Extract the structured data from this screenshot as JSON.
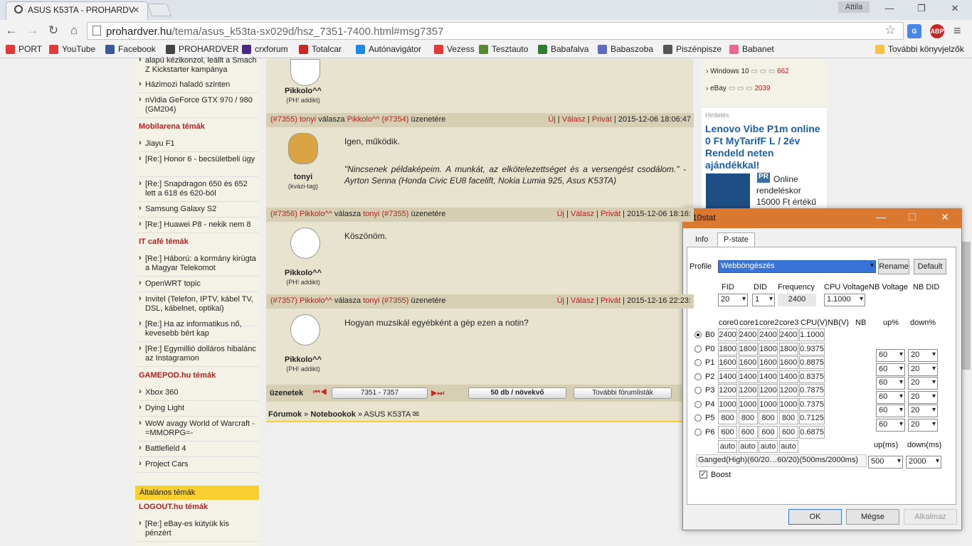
{
  "browser": {
    "tab_title": "ASUS K53TA - PROHARDV",
    "user": "Attila",
    "url_host": "prohardver.hu",
    "url_path": "/tema/asus_k53ta-sx029d/hsz_7351-7400.html#msg7357",
    "ext_abp": "ABP"
  },
  "bookmarks": [
    {
      "label": "PORT",
      "color": "#e53935"
    },
    {
      "label": "YouTube",
      "color": "#e53935"
    },
    {
      "label": "Facebook",
      "color": "#3b5998"
    },
    {
      "label": "PROHARDVER",
      "color": "#444444"
    },
    {
      "label": "crxforum",
      "color": "#4a2a80"
    },
    {
      "label": "Totalcar",
      "color": "#c62828"
    },
    {
      "label": "Autónavigátor",
      "color": "#1e88e5"
    },
    {
      "label": "Vezess",
      "color": "#e53935"
    },
    {
      "label": "Tesztauto",
      "color": "#558b2f"
    },
    {
      "label": "Babafalva",
      "color": "#2e7d32"
    },
    {
      "label": "Babaszoba",
      "color": "#5c6bc0"
    },
    {
      "label": "Piszénpisze",
      "color": "#555555"
    },
    {
      "label": "Babanet",
      "color": "#f06292"
    }
  ],
  "other_bookmarks": "További könyvjelzők",
  "sidebar": {
    "top_items": [
      "alapú kézikonzol, leállt a Smach Z Kickstarter kampánya",
      "Házimozi haladó szinten",
      "nVidia GeForce GTX 970 / 980 (GM204)"
    ],
    "mobilarena_head": "Mobilarena témák",
    "mobilarena": [
      "Jiayu F1",
      "[Re:] Honor 6 - becsületbeli ügy",
      "[Re:] Snapdragon 650 és 652 lett a 618 és 620-ból",
      "Samsung Galaxy S2",
      "[Re:] Huawei P8 - nekik nem 8"
    ],
    "itcafe_head": "IT café témák",
    "itcafe": [
      "[Re:] Háború: a kormány kirúgta a Magyar Telekomot",
      "OpenWRT topic",
      "Invitel (Telefon, IPTV, kábel TV, DSL, kábelnet, optikai)",
      "[Re:] Ha az informatikus nő, kevesebb bért kap",
      "[Re:] Egymillió dolláros hibalánc az Instagramon"
    ],
    "gamepod_head": "GAMEPOD.hu témák",
    "gamepod": [
      "Xbox 360",
      "Dying Light",
      "WoW avagy World of Warcraft -=MMORPG=-",
      "Battlefield 4",
      "Project Cars"
    ],
    "altalanos_head": "Általános témák",
    "logout_head": "LOGOUT.hu témák",
    "logout": [
      "[Re:] eBay-es kütyük kis pénzért"
    ]
  },
  "posts": [
    {
      "num": "(#7355)",
      "author": "tonyi",
      "reply_word": "válasza",
      "target": "Pikkolo^^",
      "target_num": "(#7354)",
      "tail": "üzenetére",
      "uj": "Új",
      "valasz": "Válasz",
      "privat": "Privát",
      "date": "2015-12-06 18:06:47",
      "text": "Igen, működik.",
      "quote": "\"Nincsenek példaképeim. A munkát, az elkötelezettséget és a versengést csodálom.\" - Ayrton Senna (Honda Civic EU8 facelift, Nokia Lumia 925, Asus K53TA)",
      "uname": "tonyi",
      "urank": "(kvázi-tag)"
    },
    {
      "num": "(#7356)",
      "author": "Pikkolo^^",
      "reply_word": "válasza",
      "target": "tonyi",
      "target_num": "(#7355)",
      "tail": "üzenetére",
      "uj": "Új",
      "valasz": "Válasz",
      "privat": "Privát",
      "date": "2015-12-06 18:16:",
      "text": "Köszönöm.",
      "uname": "Pikkolo^^",
      "urank": "(PH! addikt)"
    },
    {
      "num": "(#7357)",
      "author": "Pikkolo^^",
      "reply_word": "válasza",
      "target": "tonyi",
      "target_num": "(#7355)",
      "tail": "üzenetére",
      "uj": "Új",
      "valasz": "Válasz",
      "privat": "Privát",
      "date": "2015-12-16 22:23:",
      "text": "Hogyan muzsikál egyébként a gép ezen a notin?",
      "uname": "Pikkolo^^",
      "urank": "(PH! addikt)"
    }
  ],
  "prev_user": {
    "uname": "Pikkolo^^",
    "urank": "(PH! addikt)"
  },
  "pager": {
    "label": "üzenetek",
    "range": "7351 - 7357",
    "perpage": "50 db / növekvő",
    "more": "További fórumlisták"
  },
  "breadcrumb": {
    "a": "Fórumok",
    "b": "Notebookok",
    "c": "ASUS K53TA",
    "sep": "»"
  },
  "right": {
    "items": [
      {
        "label": "Windows 10",
        "count": "662"
      },
      {
        "label": "eBay",
        "count": "2039"
      }
    ],
    "ad_label": "Hirdetés",
    "ad_title": "Lenovo Vibe P1m online 0 Ft MyTarifF L / 2év Rendeld neten ajándékkal!",
    "ad_pr": "PR",
    "ad_text": "Online rendeléskor 15000 Ft értékű"
  },
  "k10": {
    "title": "K10stat",
    "tab_info": "Info",
    "tab_pstate": "P-state",
    "profile_label": "Profile",
    "profile": "Webböngészés",
    "rename": "Rename",
    "default": "Default",
    "fid_label": "FID",
    "did_label": "DID",
    "freq_label": "Frequency",
    "cpuv_label": "CPU Voltage",
    "nbv_label": "NB Voltage",
    "nbdid_label": "NB DID",
    "fid": "20",
    "did": "1",
    "freq": "2400",
    "cpuv": "1.1000",
    "col_core0": "core0",
    "col_core1": "core1",
    "col_core2": "core2",
    "col_core3": "core3",
    "col_cpuv": "CPU(V)",
    "col_nbv": "NB(V)",
    "col_nb": "NB",
    "col_up": "up%",
    "col_down": "down%",
    "rows": [
      {
        "name": "B0",
        "f": "2400",
        "v": "1.1000",
        "sel": true
      },
      {
        "name": "P0",
        "f": "1800",
        "v": "0.9375"
      },
      {
        "name": "P1",
        "f": "1600",
        "v": "0.8875"
      },
      {
        "name": "P2",
        "f": "1400",
        "v": "0.8375"
      },
      {
        "name": "P3",
        "f": "1200",
        "v": "0.7875"
      },
      {
        "name": "P4",
        "f": "1000",
        "v": "0.7375"
      },
      {
        "name": "P5",
        "f": "800",
        "v": "0.7125"
      },
      {
        "name": "P6",
        "f": "600",
        "v": "0.6875"
      }
    ],
    "updown": [
      {
        "up": "60",
        "down": "20"
      },
      {
        "up": "60",
        "down": "20"
      },
      {
        "up": "60",
        "down": "20"
      },
      {
        "up": "60",
        "down": "20"
      },
      {
        "up": "60",
        "down": "20"
      },
      {
        "up": "60",
        "down": "20"
      }
    ],
    "auto": "auto",
    "upms_label": "up(ms)",
    "downms_label": "down(ms)",
    "ganged": "Ganged(High)(60/20…60/20)(500ms/2000ms)",
    "upms": "500",
    "downms": "2000",
    "boost": "Boost",
    "ok": "OK",
    "cancel": "Mégse",
    "apply": "Alkalmaz"
  }
}
